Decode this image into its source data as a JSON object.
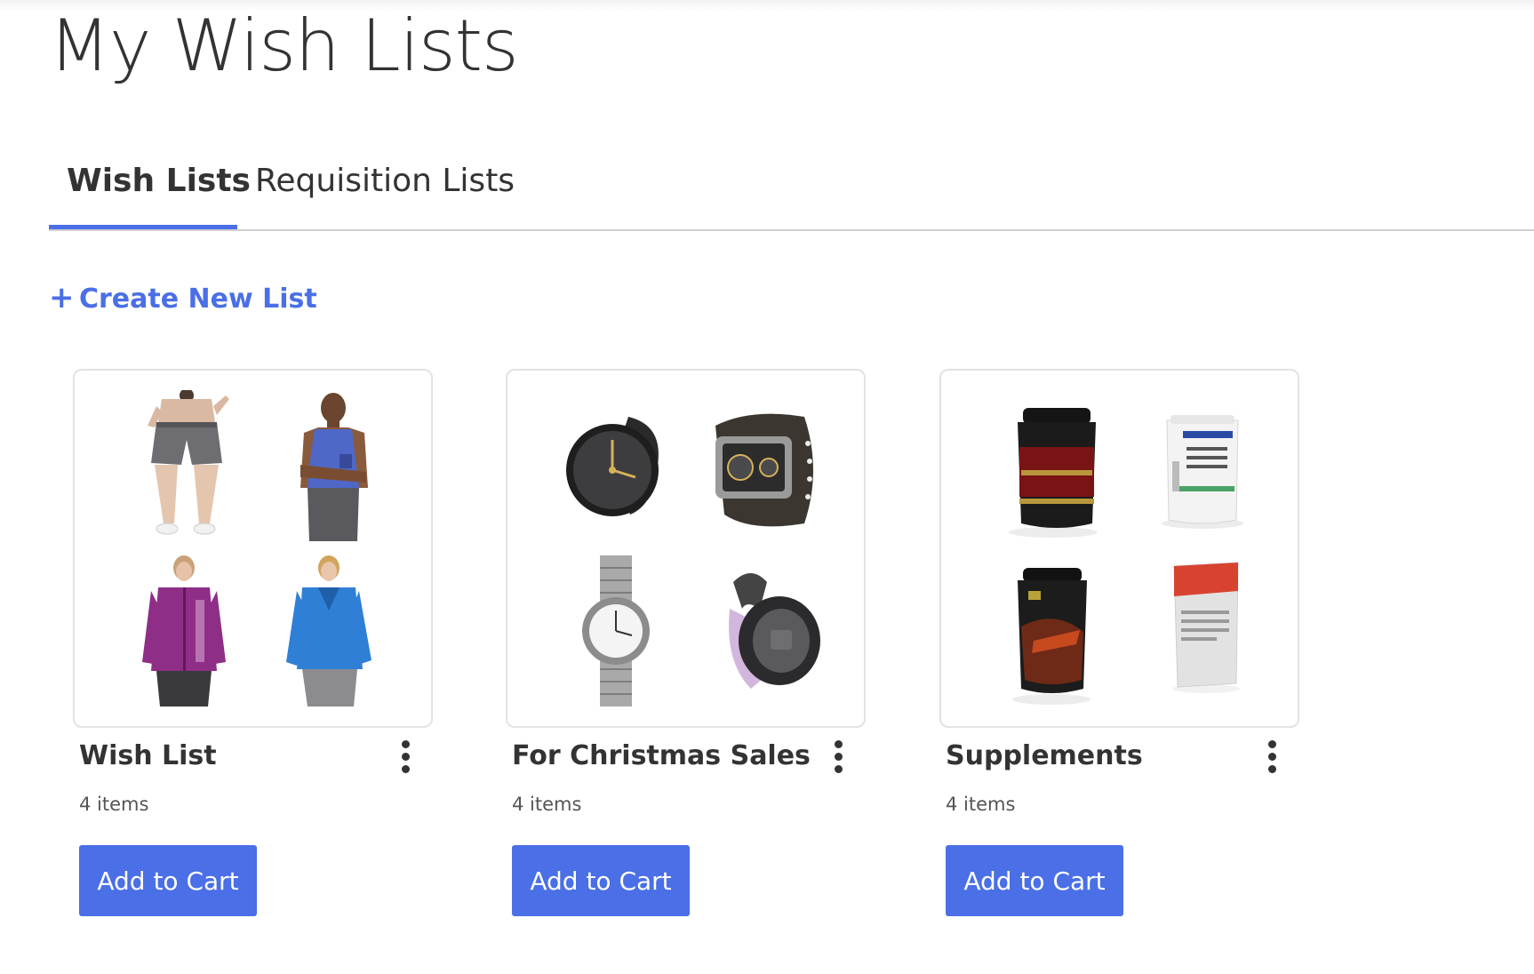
{
  "page": {
    "title": "My Wish Lists"
  },
  "tabs": [
    {
      "label": "Wish Lists",
      "active": true
    },
    {
      "label": "Requisition Lists",
      "active": false
    }
  ],
  "create_link": {
    "icon": "plus-icon",
    "label": "Create New List"
  },
  "colors": {
    "accent": "#4a6fe6",
    "text": "#333333",
    "border": "#e3e3e3"
  },
  "lists": [
    {
      "name": "Wish List",
      "count": "4 items",
      "button_label": "Add to Cart",
      "thumbnails": [
        "gray-shorts-image",
        "blue-tank-top-image",
        "purple-jacket-image",
        "blue-pullover-image"
      ]
    },
    {
      "name": "For Christmas Sales",
      "count": "4 items",
      "button_label": "Add to Cart",
      "thumbnails": [
        "black-sport-watch-image",
        "brown-leather-watch-image",
        "steel-link-watch-image",
        "pink-digital-watch-image"
      ]
    },
    {
      "name": "Supplements",
      "count": "4 items",
      "button_label": "Add to Cart",
      "thumbnails": [
        "whey-protein-tub-image",
        "b-complex-jar-image",
        "nitro-tech-tub-image",
        "sport-pouch-image"
      ]
    }
  ]
}
